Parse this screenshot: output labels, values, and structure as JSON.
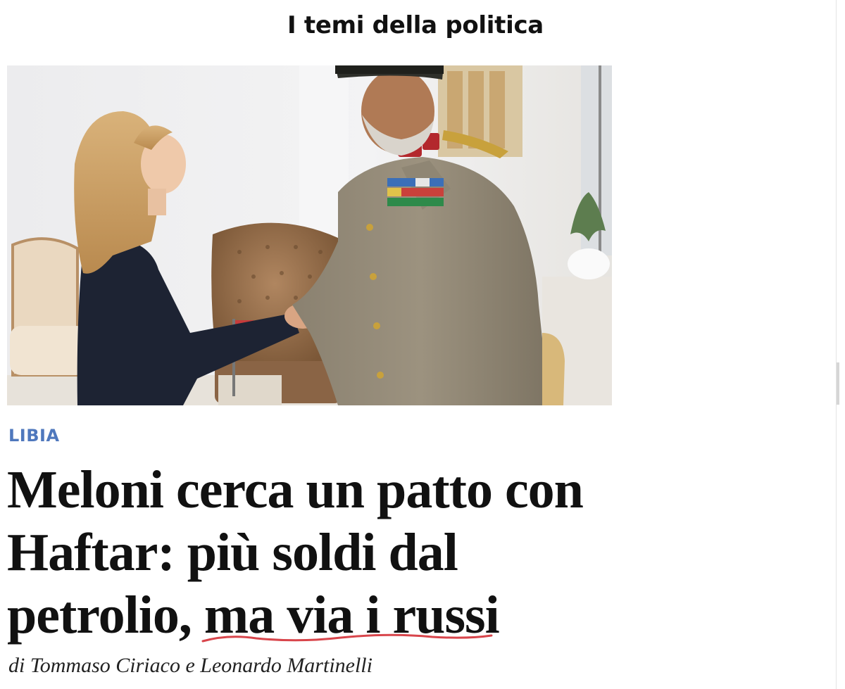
{
  "section": {
    "title": "I temi della politica"
  },
  "article": {
    "category": "LIBIA",
    "headline_lines": [
      "Meloni cerca un patto con",
      "Haftar: più soldi dal",
      "petrolio, ma via i russi"
    ],
    "byline": "di Tommaso Ciriaco e Leonardo Martinelli"
  },
  "colors": {
    "category": "#4f78bd",
    "underline_annotation": "#d8454b",
    "headline": "#111111"
  }
}
